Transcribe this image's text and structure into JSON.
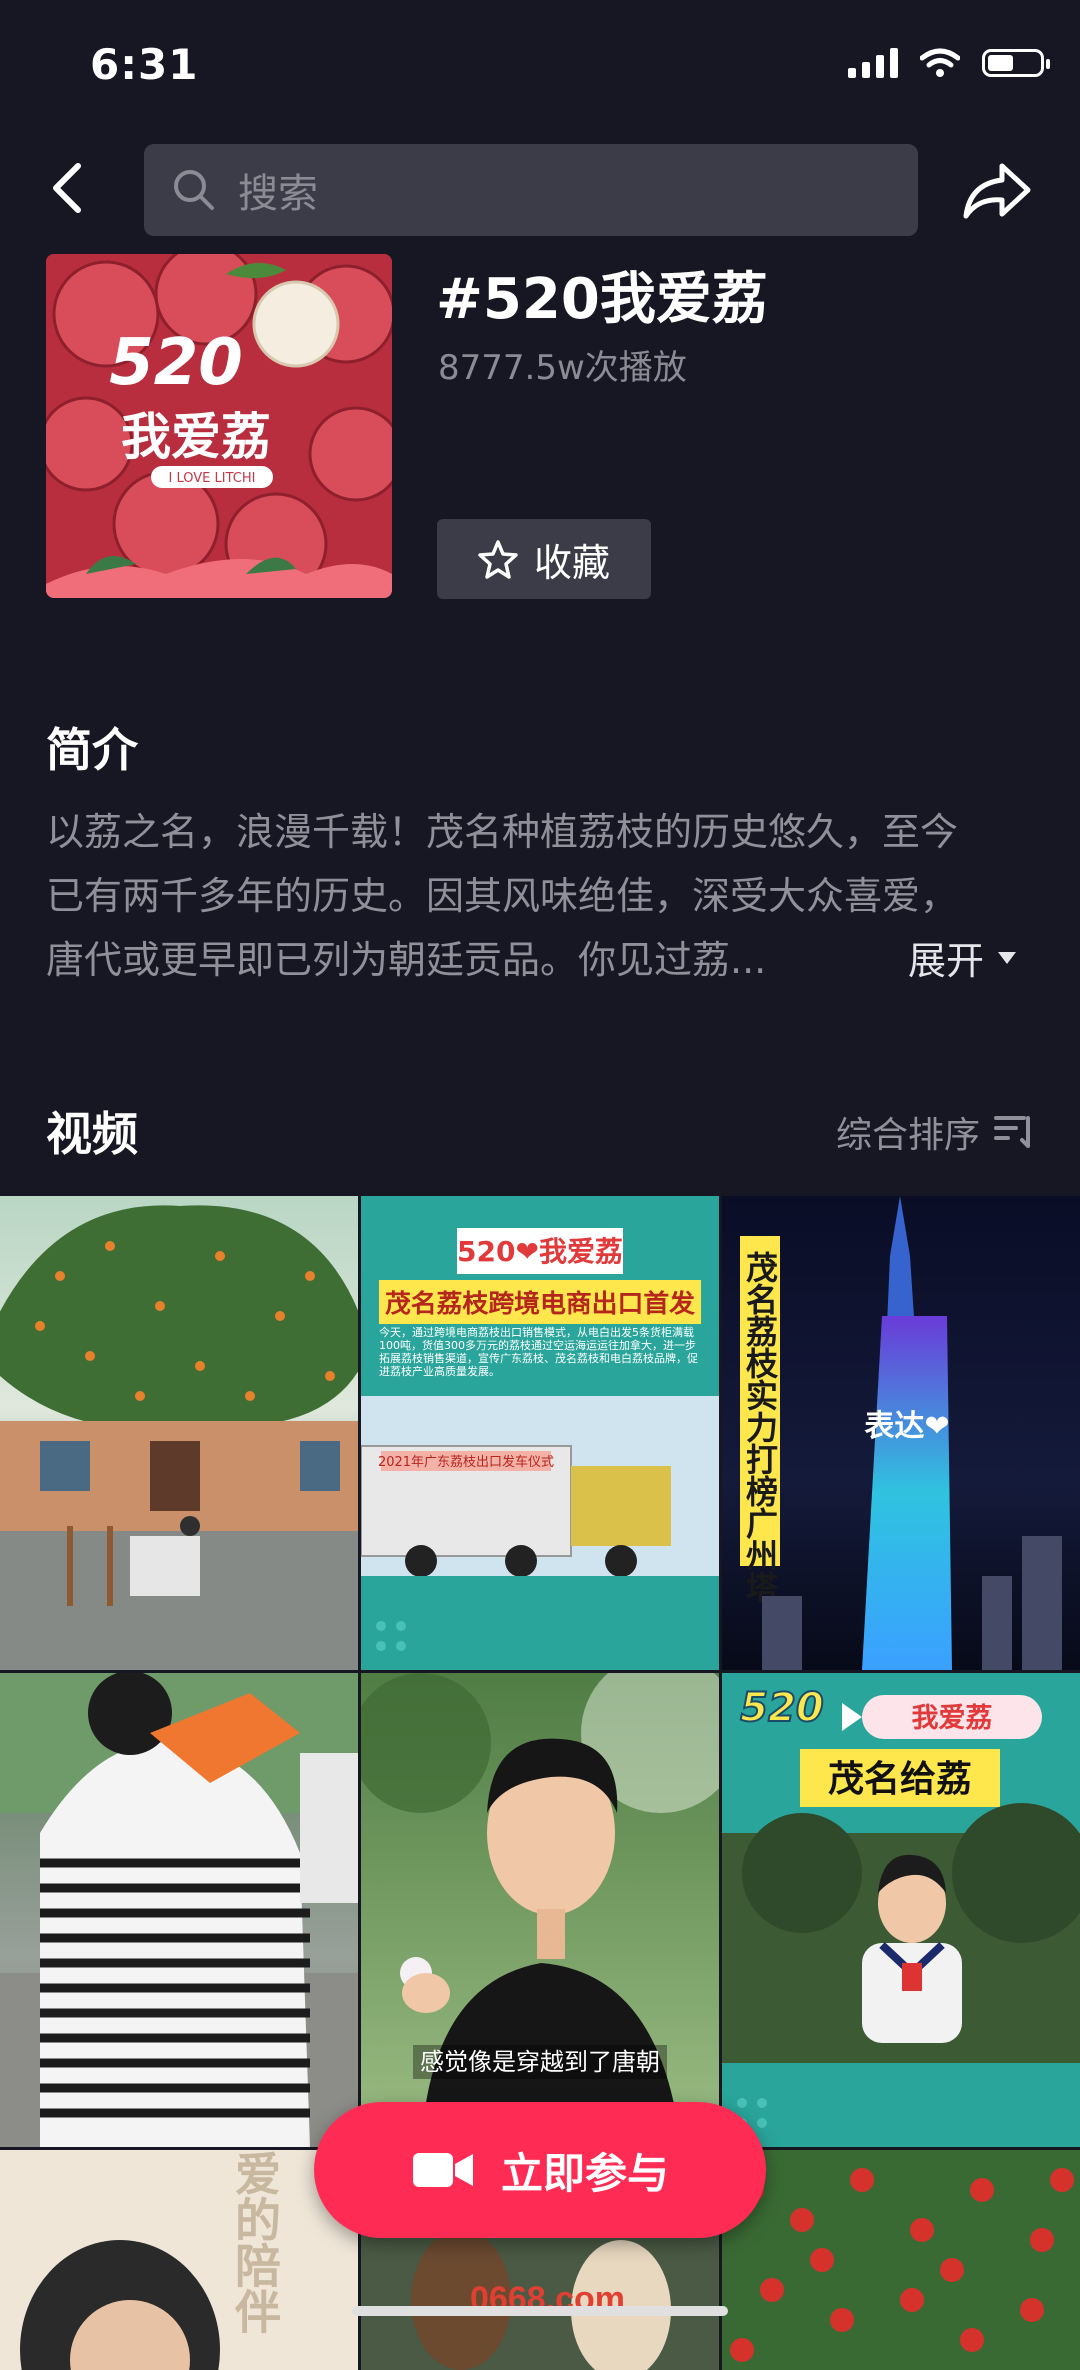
{
  "status": {
    "time": "6:31"
  },
  "search": {
    "placeholder": "搜索"
  },
  "topic": {
    "title": "#520我爱荔",
    "plays": "8777.5w次播放",
    "favorite_label": "收藏",
    "cover": {
      "big": "520",
      "sub": "我爱荔",
      "tagline": "I LOVE LITCHI"
    }
  },
  "intro": {
    "heading": "简介",
    "lines": [
      "以荔之名，浪漫千载！茂名种植荔枝的历史悠久，至今",
      "已有两千多年的历史。因其风味绝佳，深受大众喜爱，",
      "唐代或更早即已列为朝廷贡品。你见过荔..."
    ],
    "expand_label": "展开"
  },
  "videos": {
    "heading": "视频",
    "sort_label": "综合排序",
    "tiles": [
      {
        "texts": []
      },
      {
        "texts": [
          "520❤我爱荔",
          "茂名荔枝跨境电商出口首发",
          "今天，通过跨境电商荔枝出口销售模式，从电白出发5条货柜满载100吨，货值300多万元的荔枝通过空运海运运往加拿大，进一步拓展荔枝销售渠道，宣传广东荔枝、茂名荔枝和电白荔枝品牌，促进荔枝产业高质量发展。",
          "2021年广东荔枝出口发车仪式"
        ]
      },
      {
        "texts": [
          "茂名荔枝实力打榜广州塔",
          "表达❤"
        ]
      },
      {
        "texts": []
      },
      {
        "texts": [
          "感觉像是穿越到了唐朝"
        ]
      },
      {
        "texts": [
          "520",
          "我爱荔",
          "茂名给荔"
        ]
      },
      {
        "texts": [
          "爱的陪伴"
        ]
      },
      {
        "texts": []
      },
      {
        "texts": []
      }
    ]
  },
  "cta": {
    "label": "立即参与"
  },
  "watermark": "0668.com",
  "colors": {
    "background": "#161723",
    "accent": "#fe2c55",
    "panel": "#3b3c48",
    "muted": "#8f909a"
  }
}
